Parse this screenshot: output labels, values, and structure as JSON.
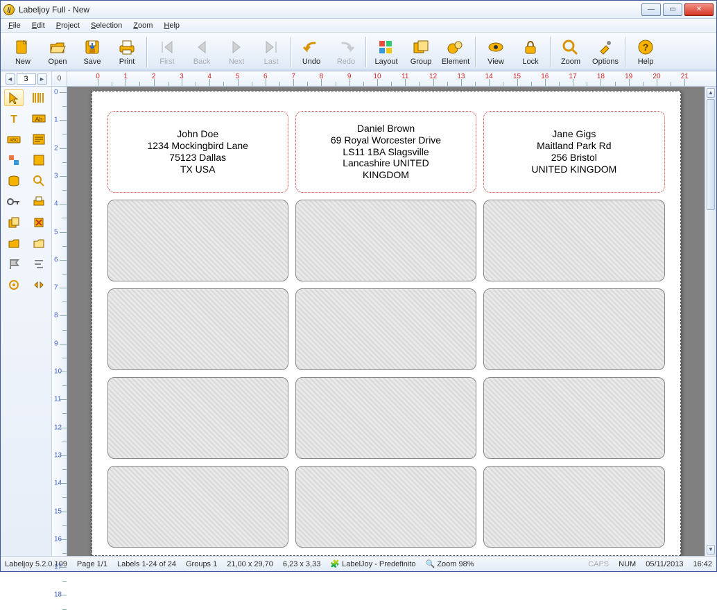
{
  "window": {
    "title": "Labeljoy Full - New"
  },
  "menu": {
    "file": "File",
    "edit": "Edit",
    "project": "Project",
    "selection": "Selection",
    "zoom": "Zoom",
    "help": "Help"
  },
  "toolbar": {
    "new": "New",
    "open": "Open",
    "save": "Save",
    "print": "Print",
    "first": "First",
    "back": "Back",
    "next": "Next",
    "last": "Last",
    "undo": "Undo",
    "redo": "Redo",
    "layout": "Layout",
    "group": "Group",
    "element": "Element",
    "view": "View",
    "lock": "Lock",
    "zoom": "Zoom",
    "options": "Options",
    "help": "Help"
  },
  "page_spinner": "3",
  "ruler_start": "0",
  "labels": [
    {
      "name": "John Doe",
      "l2": "1234 Mockingbird Lane",
      "l3": "75123 Dallas",
      "l4": "TX USA",
      "l5": ""
    },
    {
      "name": "Daniel Brown",
      "l2": "69 Royal Worcester Drive",
      "l3": "LS11 1BA Slagsville",
      "l4": "Lancashire UNITED",
      "l5": "KINGDOM"
    },
    {
      "name": "Jane Gigs",
      "l2": "Maitland Park Rd",
      "l3": "256 Bristol",
      "l4": "UNITED KINGDOM",
      "l5": ""
    }
  ],
  "status": {
    "version": "Labeljoy 5.2.0.109",
    "page": "Page 1/1",
    "labels": "Labels 1-24 of 24",
    "groups": "Groups 1",
    "dims": "21,00 x 29,70",
    "cell": "6,23 x 3,33",
    "profile": "LabelJoy - Predefinito",
    "zoom": "Zoom 98%",
    "caps": "CAPS",
    "num": "NUM",
    "date": "05/11/2013",
    "time": "16:42"
  }
}
